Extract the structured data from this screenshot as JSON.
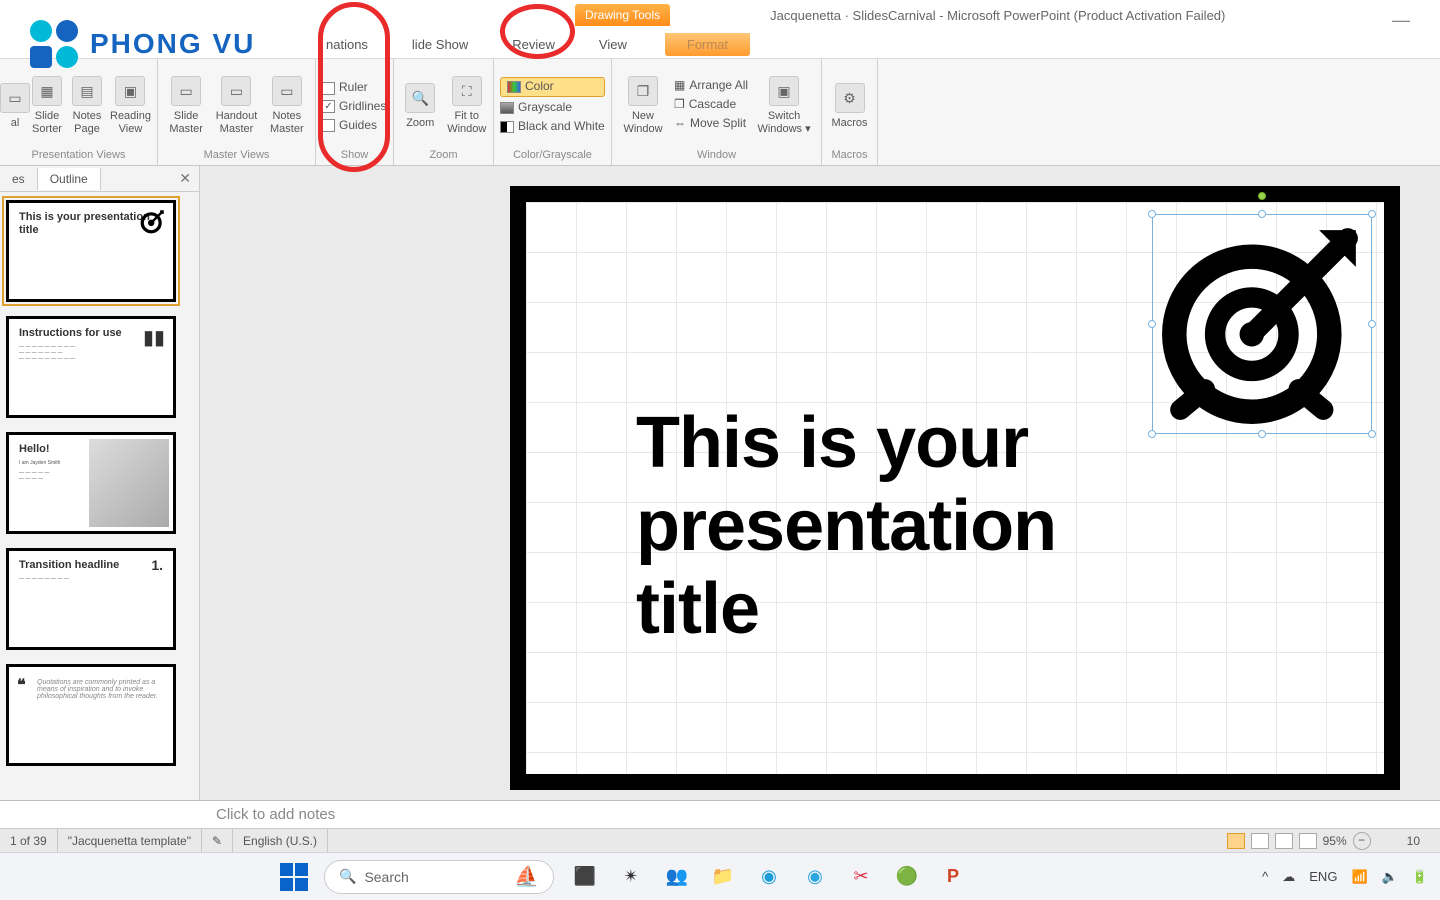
{
  "logo_text": "PHONG VU",
  "contextual_tab": "Drawing Tools",
  "window_title": "Jacquenetta · SlidesCarnival - Microsoft PowerPoint (Product Activation Failed)",
  "menu_tabs": {
    "animations": "nations",
    "slideshow": "lide Show",
    "review": "Review",
    "view": "View",
    "format": "Format"
  },
  "ribbon": {
    "views": {
      "al": "al",
      "sorter": "Slide Sorter",
      "notes": "Notes Page",
      "reading": "Reading View",
      "group": "Presentation Views"
    },
    "master": {
      "slide": "Slide Master",
      "handout": "Handout Master",
      "notes": "Notes Master",
      "group": "Master Views"
    },
    "show": {
      "ruler": "Ruler",
      "gridlines": "Gridlines",
      "guides": "Guides",
      "group": "Show"
    },
    "zoom": {
      "zoom": "Zoom",
      "fit": "Fit to Window",
      "group": "Zoom"
    },
    "color": {
      "color": "Color",
      "gray": "Grayscale",
      "bw": "Black and White",
      "group": "Color/Grayscale"
    },
    "window": {
      "new": "New Window",
      "arrange": "Arrange All",
      "cascade": "Cascade",
      "split": "Move Split",
      "switch": "Switch Windows ▾",
      "group": "Window"
    },
    "macros": {
      "macros": "Macros",
      "group": "Macros"
    }
  },
  "panetabs": {
    "slides": "es",
    "outline": "Outline"
  },
  "thumbs": [
    {
      "title": "This is your presentation title"
    },
    {
      "title": "Instructions for use"
    },
    {
      "title": "Hello!",
      "sub": "I am Jayden Smith"
    },
    {
      "title": "Transition headline",
      "num": "1."
    },
    {
      "quote": "Quotations are commonly printed as a means of inspiration and to invoke philosophical thoughts from the reader."
    }
  ],
  "slide": {
    "title": "This is your\npresentation\ntitle"
  },
  "notes_placeholder": "Click to add notes",
  "status": {
    "counter": "1 of 39",
    "template": "\"Jacquenetta template\"",
    "lang": "English (U.S.)",
    "zoom": "95%",
    "right_num": "10"
  },
  "taskbar": {
    "search": "Search",
    "lang": "ENG"
  }
}
